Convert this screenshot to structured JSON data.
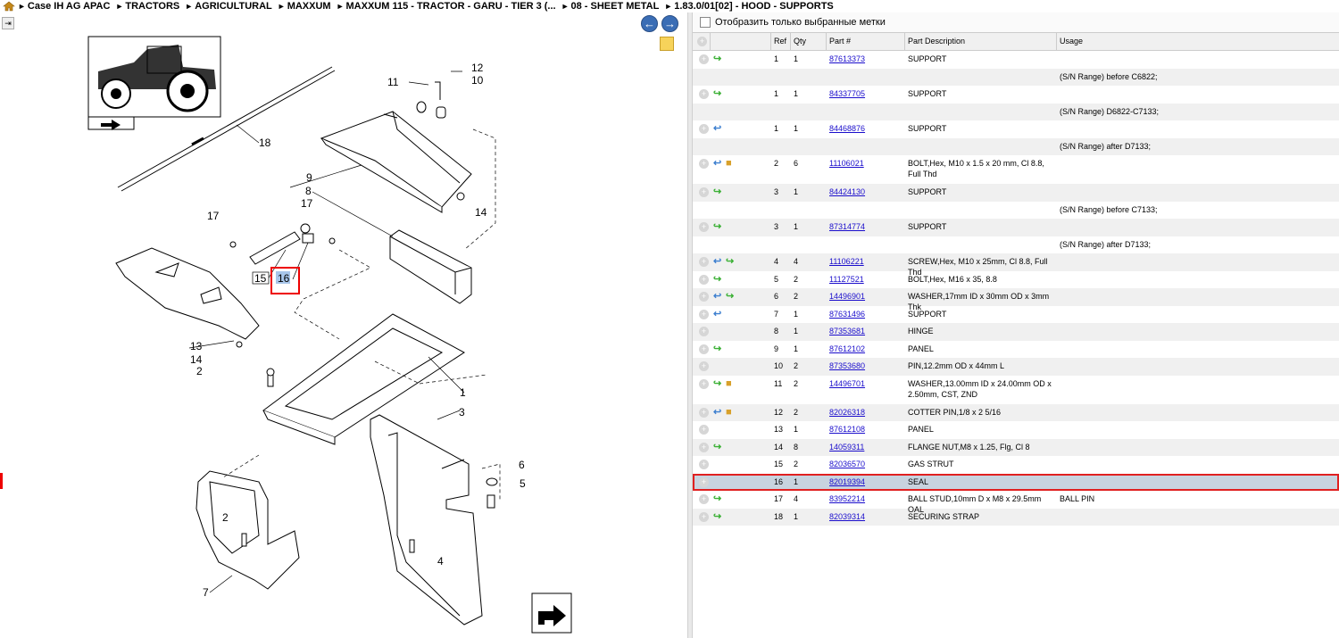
{
  "breadcrumb": [
    "Case IH AG APAC",
    "TRACTORS",
    "AGRICULTURAL",
    "MAXXUM",
    "MAXXUM 115 - TRACTOR - GARU - TIER 3 (...",
    "08 - SHEET METAL",
    "1.83.0/01[02] - HOOD - SUPPORTS"
  ],
  "filter": {
    "label": "Отобразить только выбранные метки"
  },
  "columns": {
    "ref": "Ref",
    "qty": "Qty",
    "part": "Part #",
    "desc": "Part Description",
    "usage": "Usage"
  },
  "rows": [
    {
      "ref": "1",
      "qty": "1",
      "part": "87613373",
      "desc": "SUPPORT",
      "usage": "",
      "icons": [
        "green"
      ]
    },
    {
      "ref": "",
      "qty": "",
      "part": "",
      "desc": "",
      "usage": "(S/N Range) before C6822;",
      "icons": []
    },
    {
      "ref": "1",
      "qty": "1",
      "part": "84337705",
      "desc": "SUPPORT",
      "usage": "",
      "icons": [
        "green"
      ]
    },
    {
      "ref": "",
      "qty": "",
      "part": "",
      "desc": "",
      "usage": "(S/N Range) D6822-C7133;",
      "icons": []
    },
    {
      "ref": "1",
      "qty": "1",
      "part": "84468876",
      "desc": "SUPPORT",
      "usage": "",
      "icons": [
        "blue"
      ]
    },
    {
      "ref": "",
      "qty": "",
      "part": "",
      "desc": "",
      "usage": "(S/N Range) after D7133;",
      "icons": []
    },
    {
      "ref": "2",
      "qty": "6",
      "part": "11106021",
      "desc": "BOLT,Hex, M10 x 1.5 x 20 mm, Cl 8.8, Full Thd",
      "usage": "",
      "icons": [
        "blue",
        "box"
      ]
    },
    {
      "ref": "3",
      "qty": "1",
      "part": "84424130",
      "desc": "SUPPORT",
      "usage": "",
      "icons": [
        "green"
      ]
    },
    {
      "ref": "",
      "qty": "",
      "part": "",
      "desc": "",
      "usage": "(S/N Range) before C7133;",
      "icons": []
    },
    {
      "ref": "3",
      "qty": "1",
      "part": "87314774",
      "desc": "SUPPORT",
      "usage": "",
      "icons": [
        "green"
      ]
    },
    {
      "ref": "",
      "qty": "",
      "part": "",
      "desc": "",
      "usage": "(S/N Range) after D7133;",
      "icons": []
    },
    {
      "ref": "4",
      "qty": "4",
      "part": "11106221",
      "desc": "SCREW,Hex, M10 x 25mm, Cl 8.8, Full Thd",
      "usage": "",
      "icons": [
        "blue",
        "green"
      ]
    },
    {
      "ref": "5",
      "qty": "2",
      "part": "11127521",
      "desc": "BOLT,Hex, M16 x 35, 8.8",
      "usage": "",
      "icons": [
        "green"
      ]
    },
    {
      "ref": "6",
      "qty": "2",
      "part": "14496901",
      "desc": "WASHER,17mm ID x 30mm OD x 3mm Thk",
      "usage": "",
      "icons": [
        "blue",
        "green"
      ]
    },
    {
      "ref": "7",
      "qty": "1",
      "part": "87631496",
      "desc": "SUPPORT",
      "usage": "",
      "icons": [
        "blue"
      ]
    },
    {
      "ref": "8",
      "qty": "1",
      "part": "87353681",
      "desc": "HINGE",
      "usage": "",
      "icons": []
    },
    {
      "ref": "9",
      "qty": "1",
      "part": "87612102",
      "desc": "PANEL",
      "usage": "",
      "icons": [
        "green"
      ]
    },
    {
      "ref": "10",
      "qty": "2",
      "part": "87353680",
      "desc": "PIN,12.2mm OD x 44mm L",
      "usage": "",
      "icons": []
    },
    {
      "ref": "11",
      "qty": "2",
      "part": "14496701",
      "desc": "WASHER,13.00mm ID x 24.00mm OD x 2.50mm, CST, ZND",
      "usage": "",
      "icons": [
        "green",
        "box"
      ]
    },
    {
      "ref": "12",
      "qty": "2",
      "part": "82026318",
      "desc": "COTTER PIN,1/8 x 2 5/16",
      "usage": "",
      "icons": [
        "blue",
        "box"
      ]
    },
    {
      "ref": "13",
      "qty": "1",
      "part": "87612108",
      "desc": "PANEL",
      "usage": "",
      "icons": []
    },
    {
      "ref": "14",
      "qty": "8",
      "part": "14059311",
      "desc": "FLANGE NUT,M8 x 1.25, Flg, Cl 8",
      "usage": "",
      "icons": [
        "green"
      ]
    },
    {
      "ref": "15",
      "qty": "2",
      "part": "82036570",
      "desc": "GAS STRUT",
      "usage": "",
      "icons": []
    },
    {
      "ref": "16",
      "qty": "1",
      "part": "82019394",
      "desc": "SEAL",
      "usage": "",
      "icons": [],
      "selected": true
    },
    {
      "ref": "17",
      "qty": "4",
      "part": "83952214",
      "desc": "BALL STUD,10mm D x M8 x 29.5mm OAL",
      "usage": "BALL PIN",
      "icons": [
        "green"
      ]
    },
    {
      "ref": "18",
      "qty": "1",
      "part": "82039314",
      "desc": "SECURING STRAP",
      "usage": "",
      "icons": [
        "green"
      ]
    }
  ],
  "diagram_labels": [
    "1",
    "2",
    "2",
    "3",
    "4",
    "5",
    "6",
    "7",
    "8",
    "9",
    "10",
    "11",
    "12",
    "13",
    "14",
    "14",
    "15",
    "16",
    "17",
    "17",
    "18"
  ],
  "icons": {
    "home": "home-icon",
    "prev": "arrow-left-icon",
    "next": "arrow-right-icon",
    "note": "note-icon",
    "toggle": "panel-toggle-icon",
    "tractor": "tractor-thumbnail-icon",
    "jump": "jump-arrow-icon"
  }
}
